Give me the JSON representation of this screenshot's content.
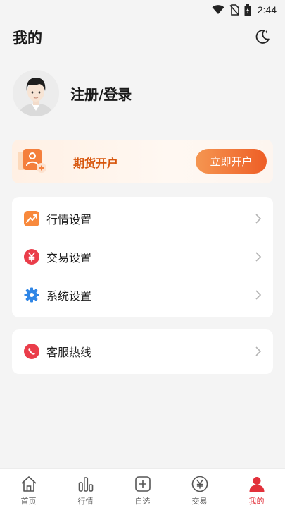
{
  "status_bar": {
    "time": "2:44"
  },
  "header": {
    "title": "我的"
  },
  "profile": {
    "login_label": "注册/登录"
  },
  "promo": {
    "label": "期货开户",
    "button_label": "立即开户"
  },
  "settings": {
    "items": [
      {
        "label": "行情设置",
        "icon": "chart-trend-icon"
      },
      {
        "label": "交易设置",
        "icon": "yen-icon"
      },
      {
        "label": "系统设置",
        "icon": "gear-icon"
      }
    ]
  },
  "support": {
    "items": [
      {
        "label": "客服热线",
        "icon": "phone-icon"
      }
    ]
  },
  "tabbar": {
    "tabs": [
      {
        "label": "首页",
        "icon": "home-icon"
      },
      {
        "label": "行情",
        "icon": "bar-chart-icon"
      },
      {
        "label": "自选",
        "icon": "plus-square-icon"
      },
      {
        "label": "交易",
        "icon": "yen-circle-icon"
      },
      {
        "label": "我的",
        "icon": "person-icon",
        "active": true
      }
    ]
  },
  "colors": {
    "accent": "#e2313b",
    "promo_text": "#d7560d",
    "promo_button": "#ee5e26"
  }
}
